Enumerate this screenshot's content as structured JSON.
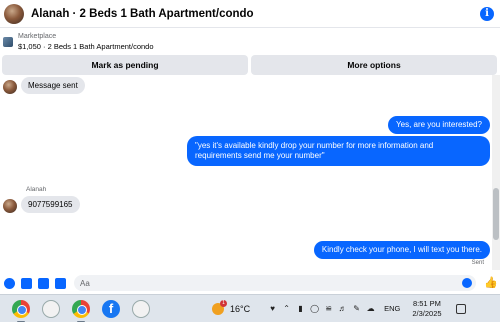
{
  "header": {
    "title": "Alanah · 2 Beds 1 Bath Apartment/condo",
    "info_icon": "info-icon",
    "info_glyph": "i"
  },
  "marketplace": {
    "label": "Marketplace",
    "item": "$1,050 · 2 Beds 1 Bath Apartment/condo"
  },
  "actions": {
    "mark_pending": "Mark as pending",
    "more_options": "More options"
  },
  "messages": [
    {
      "direction": "incoming",
      "text": "Message sent"
    },
    {
      "direction": "outgoing",
      "text": "Yes, are you interested?"
    },
    {
      "direction": "outgoing",
      "text": "\"yes it's available kindly drop your number for more information and requirements send me your number\""
    },
    {
      "direction": "incoming",
      "sender": "Alanah",
      "text": "9077599165"
    },
    {
      "direction": "outgoing",
      "text": "Kindly check your phone, I will text you there."
    }
  ],
  "sent_status": "Sent",
  "composer": {
    "placeholder": "Aa"
  },
  "taskbar": {
    "temperature": "16°C",
    "weather_badge": "1",
    "language": "ENG",
    "time": "8:51 PM",
    "date": "2/3/2025",
    "facebook_glyph": "f"
  },
  "colors": {
    "accent": "#0866ff",
    "incoming_bubble": "#e4e6eb",
    "taskbar": "#dfe5ec"
  }
}
